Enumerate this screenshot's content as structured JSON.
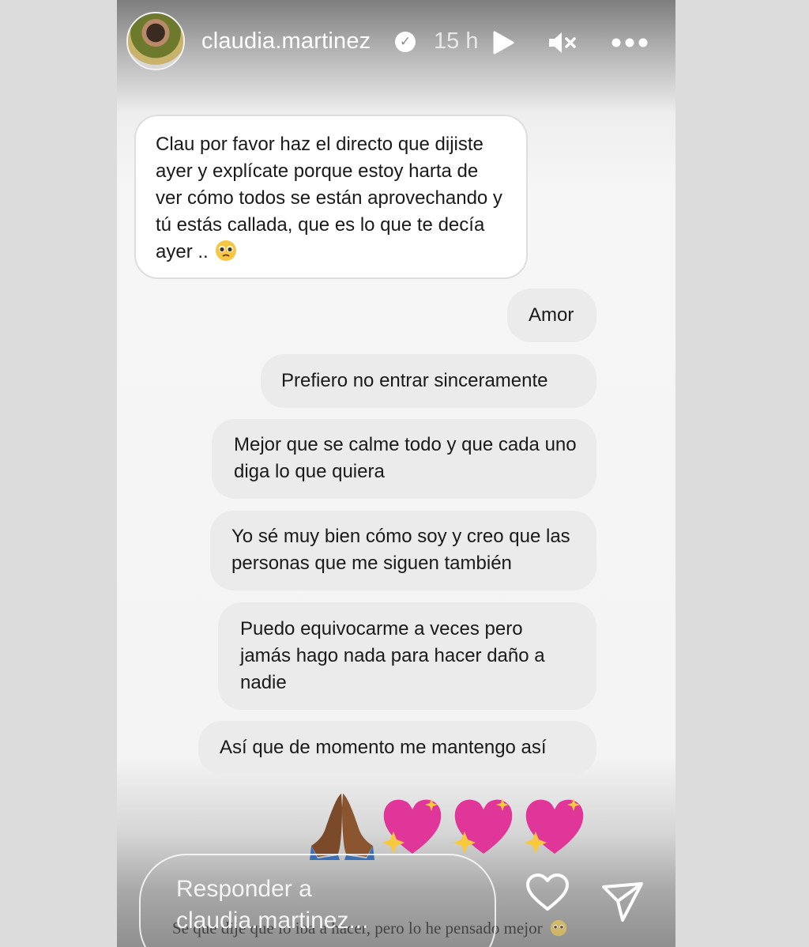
{
  "header": {
    "username": "claudia.martinez",
    "verified_mark": "✓",
    "time": "15 h",
    "icons": [
      "avatar",
      "verified-badge-icon",
      "play-icon",
      "mute-icon",
      "more-icon"
    ]
  },
  "messages": [
    {
      "side": "received",
      "text": "Clau por favor haz el directo que dijiste ayer y explícate porque estoy harta de ver cómo todos se están aprovechando y tú estás callada, que es lo que te decía ayer .."
    },
    {
      "side": "sent",
      "text": "Amor"
    },
    {
      "side": "sent",
      "text": "Prefiero no entrar sinceramente"
    },
    {
      "side": "sent",
      "text": "Mejor que se calme todo y que cada uno diga lo que quiera"
    },
    {
      "side": "sent",
      "text": "Yo sé muy bien cómo soy y creo que las personas que me siguen también"
    },
    {
      "side": "sent",
      "text": "Puedo equivocarme a veces pero jamás hago nada para hacer daño a nadie"
    },
    {
      "side": "sent",
      "text": "Así que de momento me mantengo así"
    }
  ],
  "emoji_row": [
    "praying-hands-icon",
    "sparkling-heart-icon",
    "sparkling-heart-icon",
    "sparkling-heart-icon"
  ],
  "footer": {
    "reply_label": "Responder a",
    "reply_target": "claudia.martinez...",
    "caption": "Se que dije que lo iba a hacer, pero lo he pensado mejor",
    "icons": [
      "heart-icon",
      "send-icon"
    ]
  },
  "colors": {
    "received_bubble": "#ffffff",
    "sent_bubble": "#ebebeb",
    "text": "#1a1a1a",
    "emoji_heart": "#e0369a",
    "emoji_hands": "#7a4a2a"
  }
}
